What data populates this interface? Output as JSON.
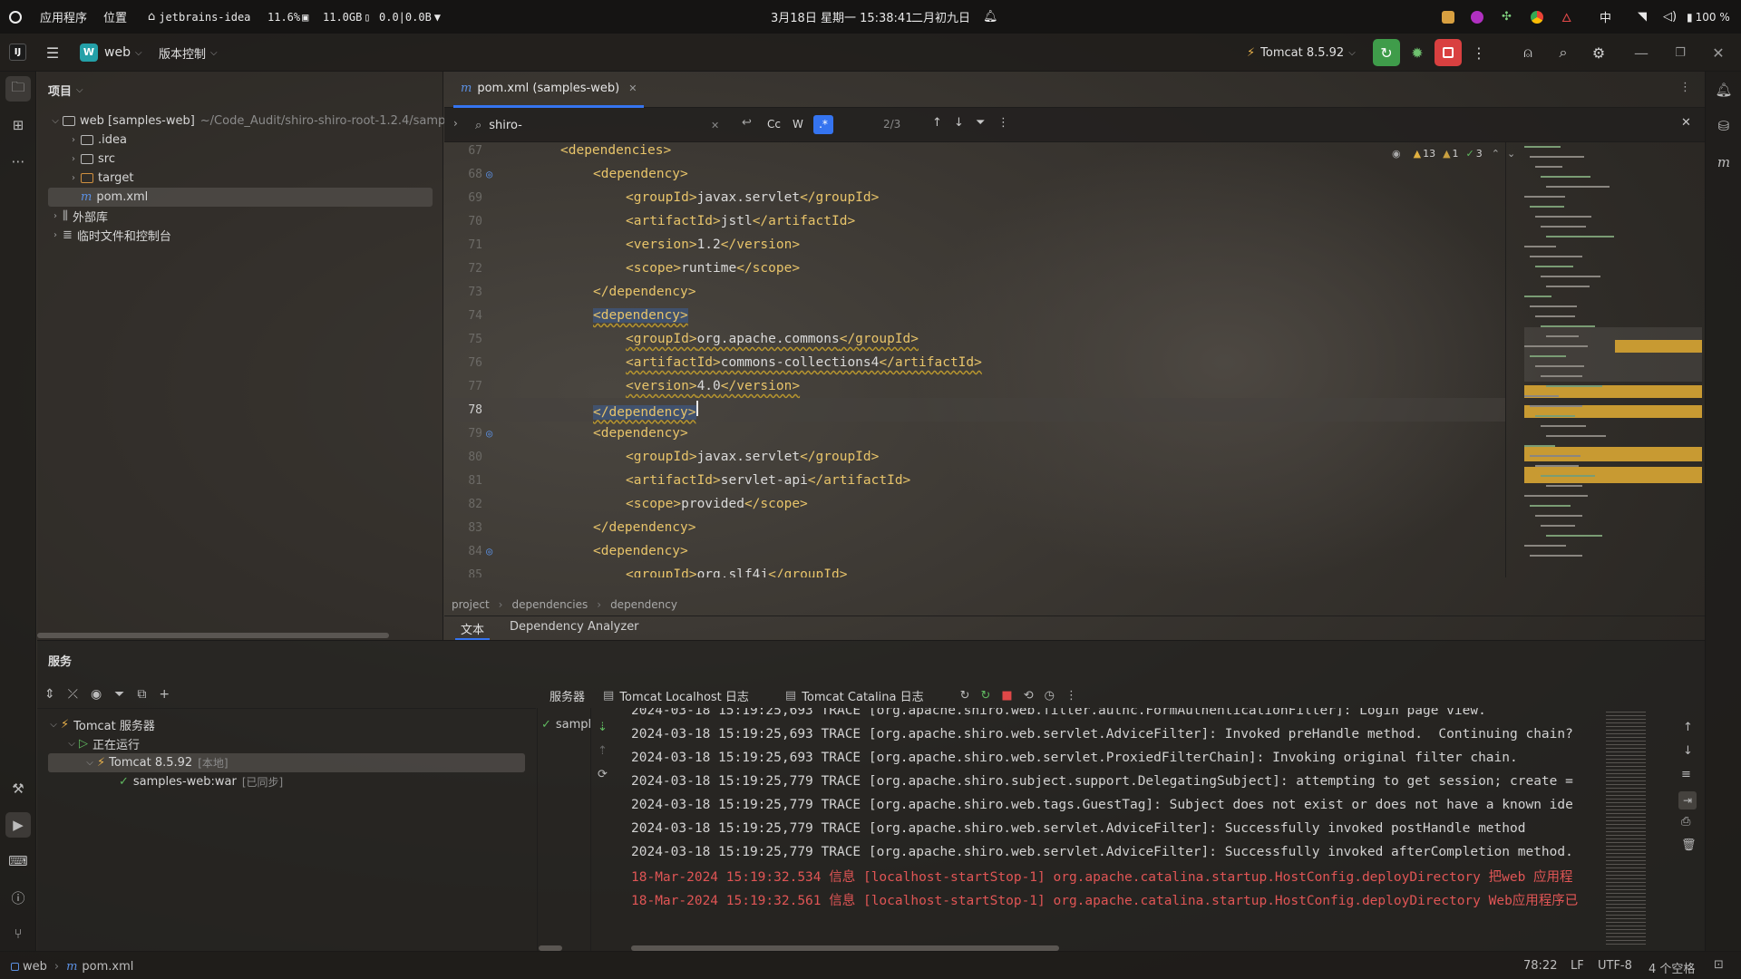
{
  "os": {
    "apps_label": "应用程序",
    "places_label": "位置",
    "active_app": "jetbrains-idea",
    "cpu": "11.6%",
    "mem": "11.0GB",
    "net": "0.0|0.0B",
    "datetime": "3月18日 星期一 15:38:41",
    "lunar": "二月初九日",
    "ime": "中",
    "battery": "100 %"
  },
  "header": {
    "project_badge": "W",
    "project_name": "web",
    "vcs_label": "版本控制",
    "run_config": "Tomcat 8.5.92"
  },
  "project_panel": {
    "title": "项目",
    "root_label": "web [samples-web]",
    "root_path": "~/Code_Audit/shiro-shiro-root-1.2.4/samp",
    "items": [
      {
        "label": ".idea"
      },
      {
        "label": "src"
      },
      {
        "label": "target"
      },
      {
        "label": "pom.xml"
      }
    ],
    "external_libs": "外部库",
    "scratches": "临时文件和控制台"
  },
  "editor": {
    "tab_label": "pom.xml (samples-web)",
    "search_value": "shiro-",
    "match_count": "2/3",
    "opt_case": "Cc",
    "opt_words": "W",
    "opt_regex": ".*",
    "inspections": {
      "warnings": "13",
      "weak": "1",
      "ok": "3"
    },
    "lines": [
      {
        "n": "67",
        "indent": 1,
        "parts": [
          {
            "c": "tag",
            "t": "<dependencies>"
          }
        ],
        "gutter": ""
      },
      {
        "n": "68",
        "indent": 2,
        "parts": [
          {
            "c": "tag",
            "t": "<dependency>"
          }
        ],
        "gutter": "maven"
      },
      {
        "n": "69",
        "indent": 3,
        "parts": [
          {
            "c": "tag",
            "t": "<groupId>"
          },
          {
            "c": "txt",
            "t": "javax.servlet"
          },
          {
            "c": "tag",
            "t": "</groupId>"
          }
        ],
        "gutter": ""
      },
      {
        "n": "70",
        "indent": 3,
        "parts": [
          {
            "c": "tag",
            "t": "<artifactId>"
          },
          {
            "c": "txt",
            "t": "jstl"
          },
          {
            "c": "tag",
            "t": "</artifactId>"
          }
        ],
        "gutter": ""
      },
      {
        "n": "71",
        "indent": 3,
        "parts": [
          {
            "c": "tag",
            "t": "<version>"
          },
          {
            "c": "txt",
            "t": "1.2"
          },
          {
            "c": "tag",
            "t": "</version>"
          }
        ],
        "gutter": ""
      },
      {
        "n": "72",
        "indent": 3,
        "parts": [
          {
            "c": "tag",
            "t": "<scope>"
          },
          {
            "c": "txt",
            "t": "runtime"
          },
          {
            "c": "tag",
            "t": "</scope>"
          }
        ],
        "gutter": ""
      },
      {
        "n": "73",
        "indent": 2,
        "parts": [
          {
            "c": "tag",
            "t": "</dependency>"
          }
        ],
        "gutter": ""
      },
      {
        "n": "74",
        "indent": 2,
        "parts": [
          {
            "c": "tag",
            "t": "<dependency>"
          }
        ],
        "gutter": "",
        "sel": true
      },
      {
        "n": "75",
        "indent": 3,
        "parts": [
          {
            "c": "tag",
            "t": "<groupId>"
          },
          {
            "c": "txt",
            "t": "org.apache.commons"
          },
          {
            "c": "tag",
            "t": "</groupId>"
          }
        ],
        "gutter": "",
        "warn": true
      },
      {
        "n": "76",
        "indent": 3,
        "parts": [
          {
            "c": "tag",
            "t": "<artifactId>"
          },
          {
            "c": "txt",
            "t": "commons-collections4"
          },
          {
            "c": "tag",
            "t": "</artifactId>"
          }
        ],
        "gutter": "",
        "warn": true
      },
      {
        "n": "77",
        "indent": 3,
        "parts": [
          {
            "c": "tag",
            "t": "<version>"
          },
          {
            "c": "txt",
            "t": "4.0"
          },
          {
            "c": "tag",
            "t": "</version>"
          }
        ],
        "gutter": "",
        "warn": true
      },
      {
        "n": "78",
        "indent": 2,
        "parts": [
          {
            "c": "tag",
            "t": "</dependency>"
          }
        ],
        "gutter": "",
        "sel": true,
        "current": true
      },
      {
        "n": "79",
        "indent": 2,
        "parts": [
          {
            "c": "tag",
            "t": "<dependency>"
          }
        ],
        "gutter": "maven"
      },
      {
        "n": "80",
        "indent": 3,
        "parts": [
          {
            "c": "tag",
            "t": "<groupId>"
          },
          {
            "c": "txt",
            "t": "javax.servlet"
          },
          {
            "c": "tag",
            "t": "</groupId>"
          }
        ],
        "gutter": ""
      },
      {
        "n": "81",
        "indent": 3,
        "parts": [
          {
            "c": "tag",
            "t": "<artifactId>"
          },
          {
            "c": "txt",
            "t": "servlet-api"
          },
          {
            "c": "tag",
            "t": "</artifactId>"
          }
        ],
        "gutter": ""
      },
      {
        "n": "82",
        "indent": 3,
        "parts": [
          {
            "c": "tag",
            "t": "<scope>"
          },
          {
            "c": "txt",
            "t": "provided"
          },
          {
            "c": "tag",
            "t": "</scope>"
          }
        ],
        "gutter": ""
      },
      {
        "n": "83",
        "indent": 2,
        "parts": [
          {
            "c": "tag",
            "t": "</dependency>"
          }
        ],
        "gutter": ""
      },
      {
        "n": "84",
        "indent": 2,
        "parts": [
          {
            "c": "tag",
            "t": "<dependency>"
          }
        ],
        "gutter": "maven"
      },
      {
        "n": "85",
        "indent": 3,
        "parts": [
          {
            "c": "tag",
            "t": "<groupId>"
          },
          {
            "c": "txt",
            "t": "org.slf4j"
          },
          {
            "c": "tag",
            "t": "</groupId>"
          }
        ],
        "gutter": ""
      }
    ],
    "breadcrumb": [
      "project",
      "dependencies",
      "dependency"
    ],
    "bottom_tabs": [
      "文本",
      "Dependency Analyzer"
    ]
  },
  "services": {
    "title": "服务",
    "tree": {
      "tomcat_server": "Tomcat 服务器",
      "running": "正在运行",
      "instance": "Tomcat 8.5.92",
      "instance_tag": "[本地]",
      "artifact": "samples-web:war",
      "artifact_tag": "[已同步]"
    },
    "deploy_item": "sampl",
    "log_tabs": [
      "服务器",
      "Tomcat Localhost 日志",
      "Tomcat Catalina 日志"
    ],
    "log_lines": [
      {
        "t": "2024-03-18 15:19:25,693 TRACE [org.apache.shiro.web.filter.authc.FormAuthenticationFilter]: Login page view.",
        "red": false
      },
      {
        "t": "2024-03-18 15:19:25,693 TRACE [org.apache.shiro.web.servlet.AdviceFilter]: Invoked preHandle method.  Continuing chain?",
        "red": false
      },
      {
        "t": "2024-03-18 15:19:25,693 TRACE [org.apache.shiro.web.servlet.ProxiedFilterChain]: Invoking original filter chain.",
        "red": false
      },
      {
        "t": "2024-03-18 15:19:25,779 TRACE [org.apache.shiro.subject.support.DelegatingSubject]: attempting to get session; create =",
        "red": false
      },
      {
        "t": "2024-03-18 15:19:25,779 TRACE [org.apache.shiro.web.tags.GuestTag]: Subject does not exist or does not have a known ide",
        "red": false
      },
      {
        "t": "2024-03-18 15:19:25,779 TRACE [org.apache.shiro.web.servlet.AdviceFilter]: Successfully invoked postHandle method",
        "red": false
      },
      {
        "t": "2024-03-18 15:19:25,779 TRACE [org.apache.shiro.web.servlet.AdviceFilter]: Successfully invoked afterCompletion method.",
        "red": false
      },
      {
        "t": "18-Mar-2024 15:19:32.534 信息 [localhost-startStop-1] org.apache.catalina.startup.HostConfig.deployDirectory 把web 应用程",
        "red": true
      },
      {
        "t": "18-Mar-2024 15:19:32.561 信息 [localhost-startStop-1] org.apache.catalina.startup.HostConfig.deployDirectory Web应用程序已",
        "red": true
      }
    ]
  },
  "status": {
    "project": "web",
    "file": "pom.xml",
    "position": "78:22",
    "line_sep": "LF",
    "encoding": "UTF-8",
    "indent": "4 个空格"
  },
  "colors": {
    "accent": "#3574f0",
    "tag": "#e8c46a",
    "run_green": "#4caf50",
    "stop_red": "#e64a4a",
    "log_red": "#e05555"
  }
}
